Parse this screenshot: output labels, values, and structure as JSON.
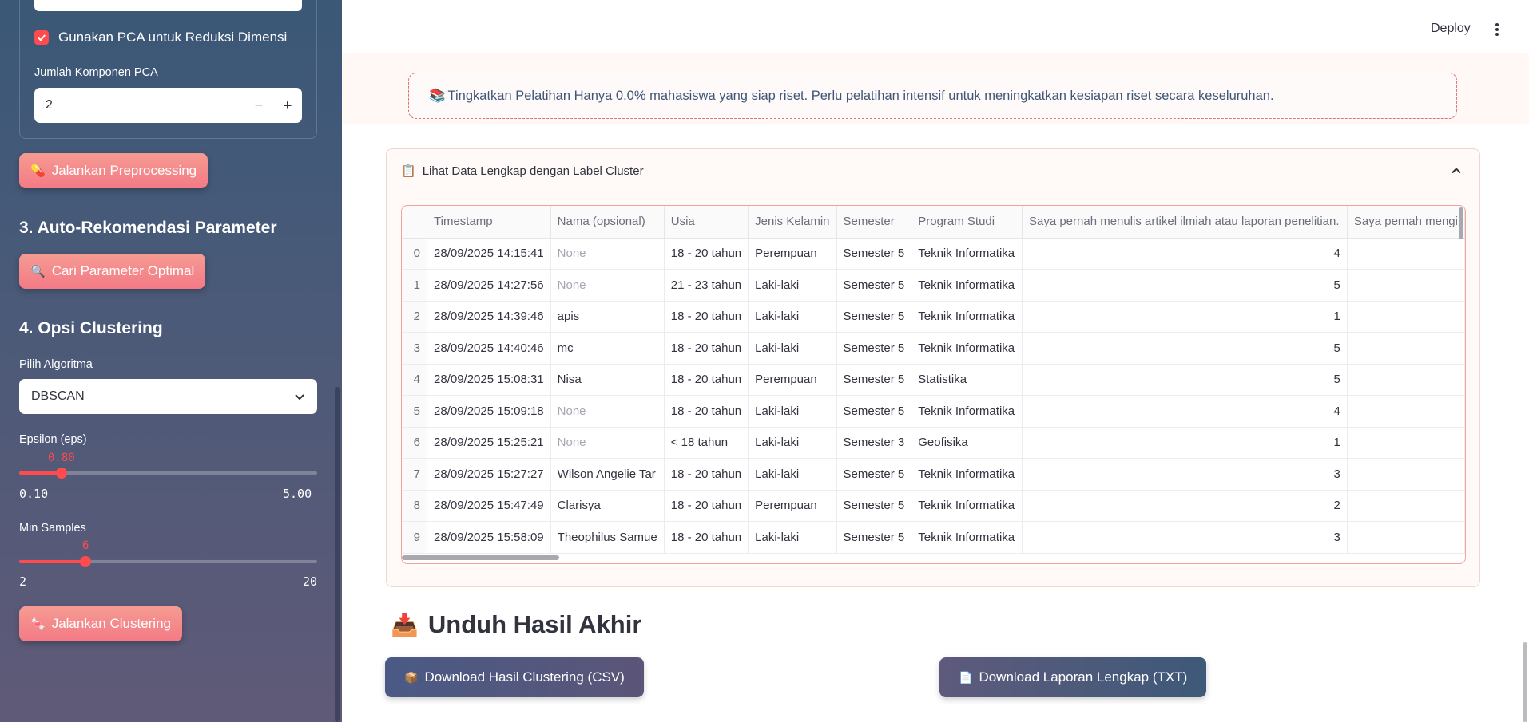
{
  "sidebar": {
    "pca_checkbox_label": "Gunakan PCA untuk Reduksi Dimensi",
    "pca_checked": true,
    "pca_components_label": "Jumlah Komponen PCA",
    "pca_components_value": "2",
    "run_preprocessing_label": "Jalankan Preprocessing",
    "section3_title": "3. Auto-Rekomendasi Parameter",
    "find_params_label": "Cari Parameter Optimal",
    "section4_title": "4. Opsi Clustering",
    "algorithm_label": "Pilih Algoritma",
    "algorithm_value": "DBSCAN",
    "eps_label": "Epsilon (eps)",
    "eps_value": "0.80",
    "eps_min": "0.10",
    "eps_max": "5.00",
    "eps_fraction": 0.143,
    "min_samples_label": "Min Samples",
    "min_samples_value": "6",
    "min_samples_min": "2",
    "min_samples_max": "20",
    "min_samples_fraction": 0.222,
    "run_clustering_label": "Jalankan Clustering",
    "accent_color": "#ff4b4b"
  },
  "header": {
    "deploy_label": "Deploy"
  },
  "alert": {
    "icon": "📚",
    "text": "Tingkatkan Pelatihan Hanya 0.0% mahasiswa yang siap riset. Perlu pelatihan intensif untuk meningkatkan kesiapan riset secara keseluruhan."
  },
  "expander": {
    "icon": "📋",
    "title": "Lihat Data Lengkap dengan Label Cluster"
  },
  "table": {
    "columns": [
      "",
      "Timestamp",
      "Nama (opsional)",
      "Usia",
      "Jenis Kelamin",
      "Semester",
      "Program Studi",
      "Saya pernah menulis artikel ilmiah atau laporan penelitian.",
      "Saya pernah mengi"
    ],
    "rows": [
      [
        "0",
        "28/09/2025 14:15:41",
        "None",
        "18 - 20 tahun",
        "Perempuan",
        "Semester 5",
        "Teknik Informatika",
        "4",
        ""
      ],
      [
        "1",
        "28/09/2025 14:27:56",
        "None",
        "21 - 23 tahun",
        "Laki-laki",
        "Semester 5",
        "Teknik Informatika",
        "5",
        ""
      ],
      [
        "2",
        "28/09/2025 14:39:46",
        "apis",
        "18 - 20 tahun",
        "Laki-laki",
        "Semester 5",
        "Teknik Informatika",
        "1",
        ""
      ],
      [
        "3",
        "28/09/2025 14:40:46",
        "mc",
        "18 - 20 tahun",
        "Laki-laki",
        "Semester 5",
        "Teknik Informatika",
        "5",
        ""
      ],
      [
        "4",
        "28/09/2025 15:08:31",
        "Nisa",
        "18 - 20 tahun",
        "Perempuan",
        "Semester 5",
        "Statistika",
        "5",
        ""
      ],
      [
        "5",
        "28/09/2025 15:09:18",
        "None",
        "18 - 20 tahun",
        "Laki-laki",
        "Semester 5",
        "Teknik Informatika",
        "4",
        ""
      ],
      [
        "6",
        "28/09/2025 15:25:21",
        "None",
        "< 18 tahun",
        "Laki-laki",
        "Semester 3",
        "Geofisika",
        "1",
        ""
      ],
      [
        "7",
        "28/09/2025 15:27:27",
        "Wilson Angelie Tar",
        "18 - 20 tahun",
        "Laki-laki",
        "Semester 5",
        "Teknik Informatika",
        "3",
        ""
      ],
      [
        "8",
        "28/09/2025 15:47:49",
        "Clarisya",
        "18 - 20 tahun",
        "Perempuan",
        "Semester 5",
        "Teknik Informatika",
        "2",
        ""
      ],
      [
        "9",
        "28/09/2025 15:58:09",
        "Theophilus Samue",
        "18 - 20 tahun",
        "Laki-laki",
        "Semester 5",
        "Teknik Informatika",
        "3",
        ""
      ]
    ]
  },
  "download": {
    "title_icon": "📥",
    "title": "Unduh Hasil Akhir",
    "csv_icon": "📦",
    "csv_label": "Download Hasil Clustering (CSV)",
    "txt_icon": "📄",
    "txt_label": "Download Laporan Lengkap (TXT)"
  }
}
